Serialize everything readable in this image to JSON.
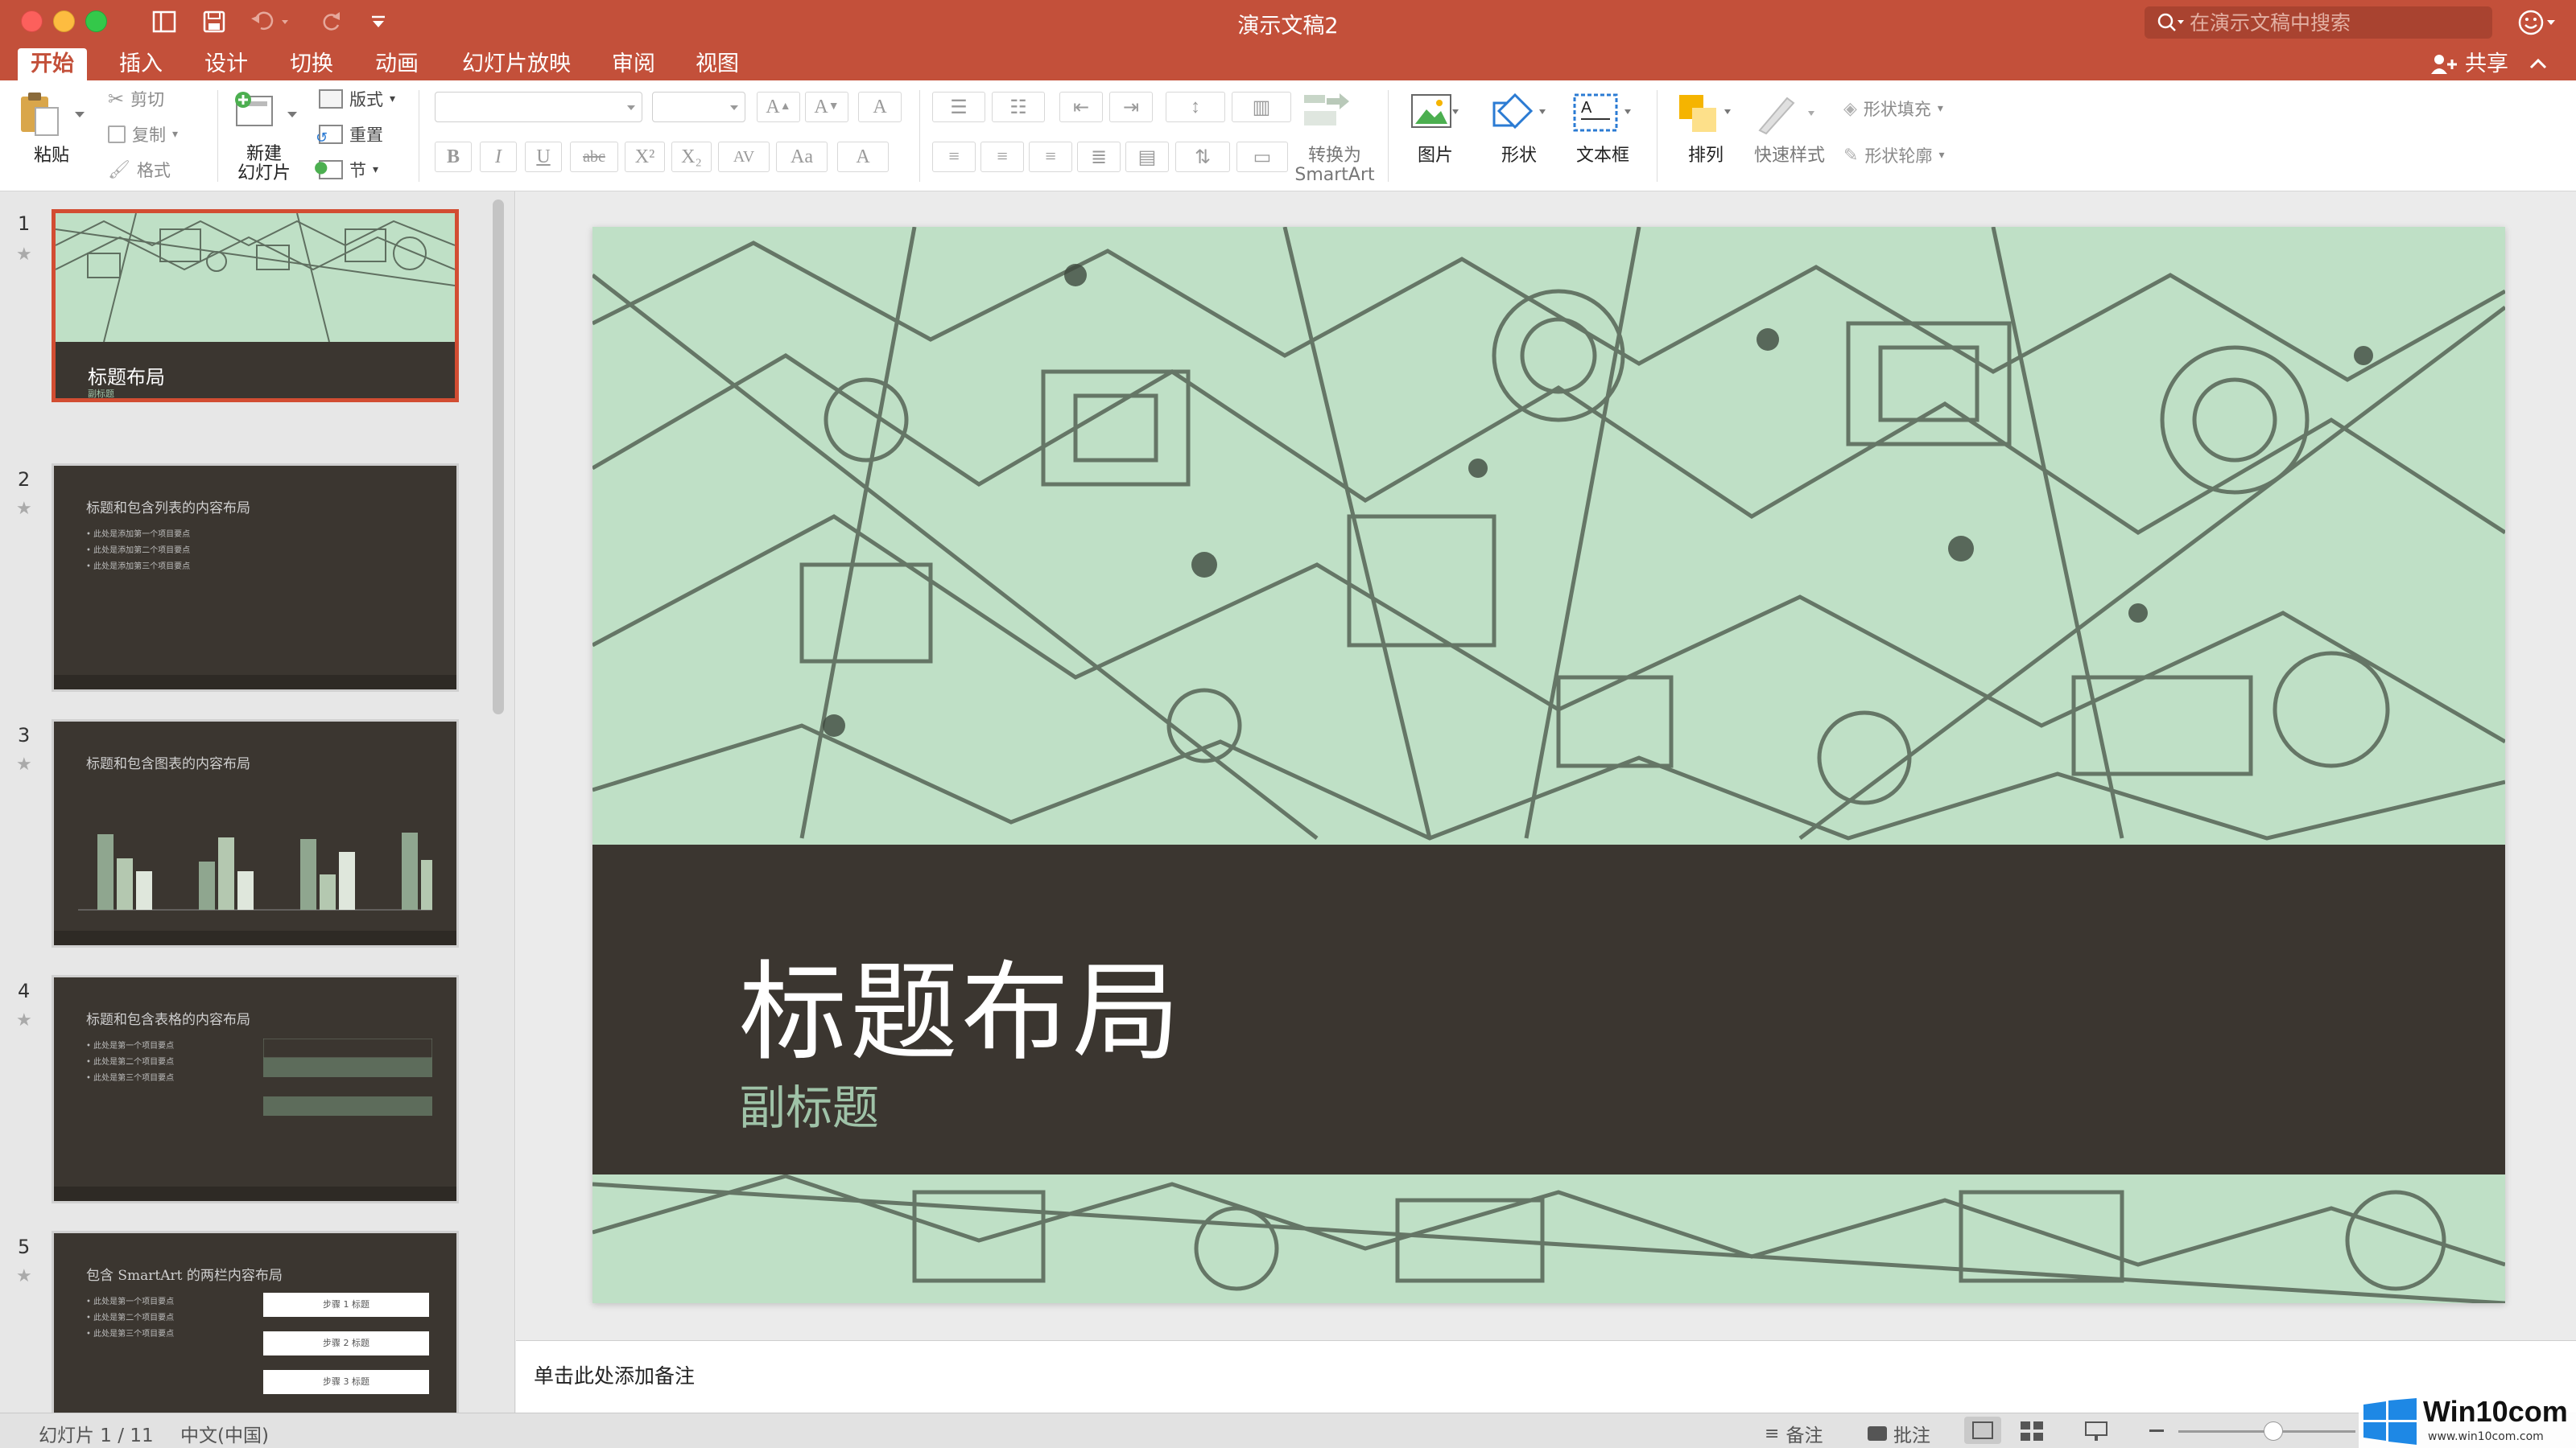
{
  "window": {
    "title": "演示文稿2"
  },
  "search": {
    "placeholder": "在演示文稿中搜索"
  },
  "tabs": [
    "开始",
    "插入",
    "设计",
    "切换",
    "动画",
    "幻灯片放映",
    "审阅",
    "视图"
  ],
  "share_label": "共享",
  "ribbon": {
    "paste": "粘贴",
    "cut": "剪切",
    "copy": "复制",
    "format": "格式",
    "new_slide": [
      "新建",
      "幻灯片"
    ],
    "layout": "版式",
    "reset": "重置",
    "section": "节",
    "convert_smartart": [
      "转换为",
      "SmartArt"
    ],
    "picture": "图片",
    "shape": "形状",
    "textbox": "文本框",
    "arrange": "排列",
    "quick_styles": "快速样式",
    "shape_fill": "形状填充",
    "shape_outline": "形状轮廓"
  },
  "slides": [
    {
      "num": "1",
      "title": "标题布局",
      "subtitle": "副标题"
    },
    {
      "num": "2",
      "title": "标题和包含列表的内容布局",
      "bullets": [
        "此处是添加第一个项目要点",
        "此处是添加第二个项目要点",
        "此处是添加第三个项目要点"
      ]
    },
    {
      "num": "3",
      "title": "标题和包含图表的内容布局"
    },
    {
      "num": "4",
      "title": "标题和包含表格的内容布局",
      "bullets": [
        "此处是第一个项目要点",
        "此处是第二个项目要点",
        "此处是第三个项目要点"
      ]
    },
    {
      "num": "5",
      "title": "包含 SmartArt 的两栏内容布局",
      "bullets": [
        "此处是第一个项目要点",
        "此处是第二个项目要点",
        "此处是第三个项目要点"
      ],
      "steps": [
        "步骤 1 标题",
        "步骤 2 标题",
        "步骤 3 标题"
      ]
    }
  ],
  "main_slide": {
    "title": "标题布局",
    "subtitle": "副标题"
  },
  "notes_placeholder": "单击此处添加备注",
  "status": {
    "slide_counter": "幻灯片 1 / 11",
    "language": "中文(中国)",
    "notes": "备注",
    "comments": "批注"
  },
  "colors": {
    "accent": "#c3503a",
    "slide_band": "#3b3630",
    "slide_bg": "#bfe0c6"
  },
  "watermark": {
    "brand": "Win10com",
    "url": "www.win10com.com"
  }
}
